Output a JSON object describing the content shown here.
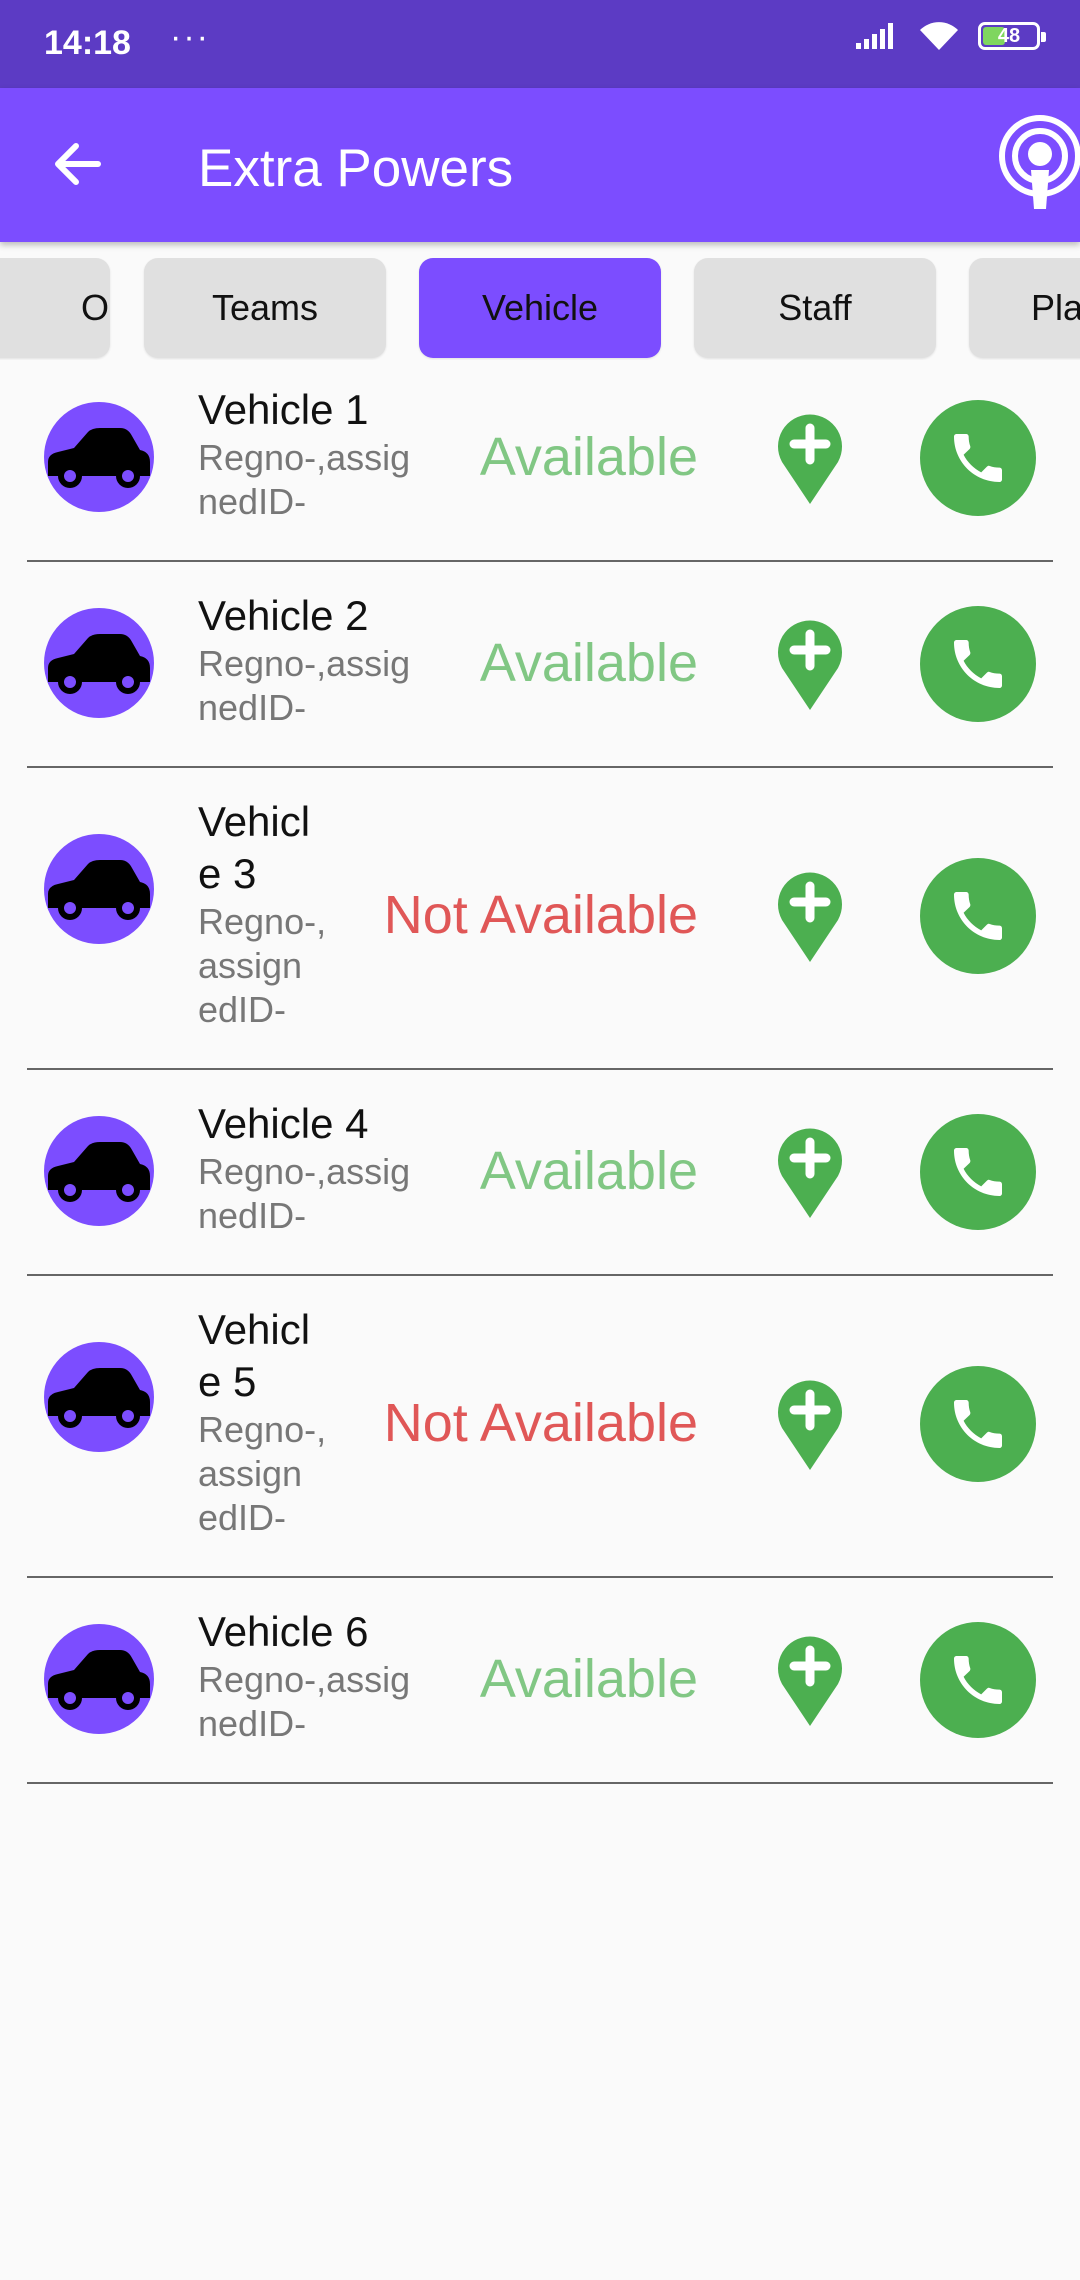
{
  "status_bar": {
    "time": "14:18",
    "dots": "···",
    "battery": "48"
  },
  "app_bar": {
    "title": "Extra Powers",
    "back_icon": "arrow-left-icon",
    "action_icon": "podcast-icon"
  },
  "tabs": [
    {
      "label": "O",
      "selected": false
    },
    {
      "label": "Teams",
      "selected": false
    },
    {
      "label": "Vehicle",
      "selected": true
    },
    {
      "label": "Staff",
      "selected": false
    },
    {
      "label": "Pla",
      "selected": false
    }
  ],
  "vehicles": [
    {
      "name": "Vehicle 1",
      "name_lines": [
        "Vehicle 1"
      ],
      "sub_lines": [
        "Regno-,assig",
        "nedID-"
      ],
      "status": "Available"
    },
    {
      "name": "Vehicle 2",
      "name_lines": [
        "Vehicle 2"
      ],
      "sub_lines": [
        "Regno-,assig",
        "nedID-"
      ],
      "status": "Available"
    },
    {
      "name": "Vehicle 3",
      "name_lines": [
        "Vehicl",
        "e 3"
      ],
      "sub_lines": [
        "Regno-,",
        "assign",
        "edID-"
      ],
      "status": "Not Available"
    },
    {
      "name": "Vehicle 4",
      "name_lines": [
        "Vehicle 4"
      ],
      "sub_lines": [
        "Regno-,assig",
        "nedID-"
      ],
      "status": "Available"
    },
    {
      "name": "Vehicle 5",
      "name_lines": [
        "Vehicl",
        "e 5"
      ],
      "sub_lines": [
        "Regno-,",
        "assign",
        "edID-"
      ],
      "status": "Not Available"
    },
    {
      "name": "Vehicle 6",
      "name_lines": [
        "Vehicle 6"
      ],
      "sub_lines": [
        "Regno-,assig",
        "nedID-"
      ],
      "status": "Available"
    }
  ],
  "colors": {
    "status_bar": "#5c3bc4",
    "app_bar": "#7c4dff",
    "available": "#81c784",
    "not_available": "#e05757",
    "action_green": "#4caf50"
  }
}
